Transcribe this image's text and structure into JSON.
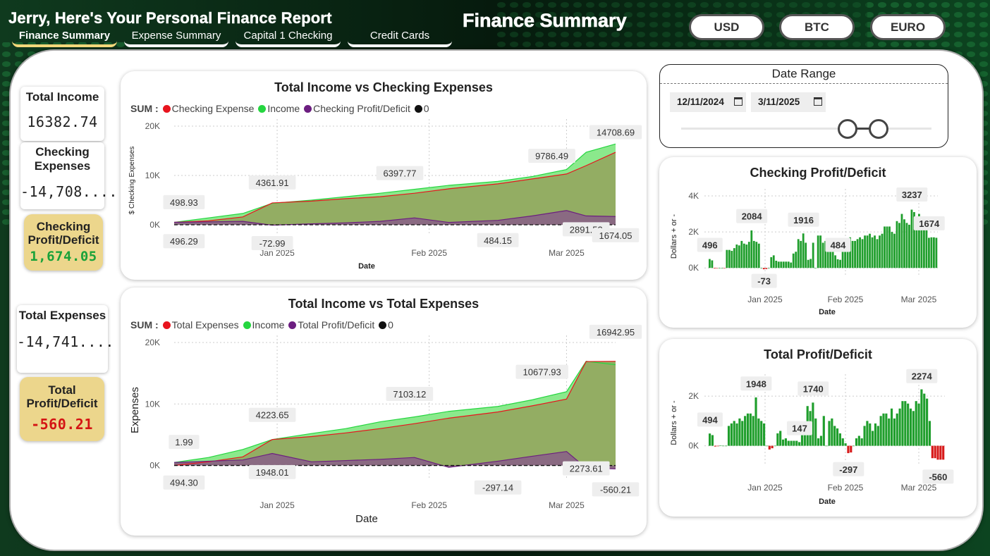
{
  "header": {
    "report_title": "Jerry, Here's Your Personal Finance Report",
    "page_heading": "Finance Summary",
    "tabs": [
      {
        "label": "Finance Summary",
        "active": true
      },
      {
        "label": "Expense Summary",
        "active": false
      },
      {
        "label": "Capital 1 Checking",
        "active": false
      },
      {
        "label": "Credit Cards",
        "active": false
      }
    ],
    "currency_buttons": [
      "USD",
      "BTC",
      "EURO"
    ]
  },
  "kpis": {
    "total_income": {
      "label": "Total Income",
      "value": "16382.74"
    },
    "checking_expenses": {
      "label": "Checking Expenses",
      "value": "-14,708...."
    },
    "checking_profit": {
      "label": "Checking Profit/Deficit",
      "value": "1,674.05",
      "color": "#1aa23a"
    },
    "total_expenses": {
      "label": "Total Expenses",
      "value": "-14,741...."
    },
    "total_profit": {
      "label": "Total Profit/Deficit",
      "value": "-560.21",
      "color": "#d41414"
    }
  },
  "date_range": {
    "label": "Date Range",
    "start": "12/11/2024",
    "end": "3/11/2025"
  },
  "colors": {
    "expense": "#e8141e",
    "income": "#25d640",
    "profit": "#6c1e80",
    "zero": "#111111",
    "area_income": "#8be98c",
    "area_expense": "#93ad63",
    "area_profit": "#8a6a82",
    "bar_pos": "#1f9e2c",
    "bar_neg": "#d71a1a",
    "gold": "#ecd68c"
  },
  "chart_data": [
    {
      "id": "income_vs_checking",
      "type": "area",
      "title": "Total Income vs Checking Expenses",
      "legend_title": "SUM :",
      "legend": [
        "Checking Expense",
        "Income",
        "Checking Profit/Deficit",
        "0"
      ],
      "xlabel": "Date",
      "ylabel": "$ Checking Expenses",
      "x_range": [
        "2024-12-11",
        "2025-03-11"
      ],
      "x_ticks": [
        {
          "date": "2025-01-01",
          "label": "Jan 2025"
        },
        {
          "date": "2025-02-01",
          "label": "Feb 2025"
        },
        {
          "date": "2025-03-01",
          "label": "Mar 2025"
        }
      ],
      "y_ticks": [
        {
          "v": 0,
          "label": "0K"
        },
        {
          "v": 10000,
          "label": "10K"
        },
        {
          "v": 20000,
          "label": "20K"
        }
      ],
      "ylim": [
        -2000,
        20000
      ],
      "series": [
        {
          "name": "Income",
          "points": [
            [
              "2024-12-11",
              496
            ],
            [
              "2024-12-18",
              1400
            ],
            [
              "2024-12-25",
              2300
            ],
            [
              "2024-12-31",
              4362
            ],
            [
              "2025-01-08",
              5000
            ],
            [
              "2025-01-15",
              5700
            ],
            [
              "2025-01-22",
              6398
            ],
            [
              "2025-01-29",
              7200
            ],
            [
              "2025-02-05",
              8000
            ],
            [
              "2025-02-15",
              8800
            ],
            [
              "2025-02-22",
              9786
            ],
            [
              "2025-03-01",
              11200
            ],
            [
              "2025-03-05",
              14709
            ],
            [
              "2025-03-11",
              16383
            ]
          ]
        },
        {
          "name": "Checking Expense",
          "points": [
            [
              "2024-12-11",
              499
            ],
            [
              "2024-12-18",
              800
            ],
            [
              "2024-12-25",
              1600
            ],
            [
              "2024-12-31",
              4435
            ],
            [
              "2025-01-08",
              4800
            ],
            [
              "2025-01-15",
              5300
            ],
            [
              "2025-01-22",
              5700
            ],
            [
              "2025-01-29",
              6400
            ],
            [
              "2025-02-05",
              7300
            ],
            [
              "2025-02-15",
              8300
            ],
            [
              "2025-02-22",
              9300
            ],
            [
              "2025-03-01",
              10300
            ],
            [
              "2025-03-05",
              12000
            ],
            [
              "2025-03-11",
              14708
            ]
          ]
        },
        {
          "name": "Checking Profit/Deficit",
          "points": [
            [
              "2024-12-11",
              496
            ],
            [
              "2024-12-18",
              600
            ],
            [
              "2024-12-25",
              700
            ],
            [
              "2024-12-31",
              -73
            ],
            [
              "2025-01-08",
              200
            ],
            [
              "2025-01-15",
              400
            ],
            [
              "2025-01-22",
              700
            ],
            [
              "2025-01-29",
              1400
            ],
            [
              "2025-02-05",
              484
            ],
            [
              "2025-02-15",
              900
            ],
            [
              "2025-02-22",
              1800
            ],
            [
              "2025-03-01",
              2892
            ],
            [
              "2025-03-05",
              1800
            ],
            [
              "2025-03-11",
              1674
            ]
          ]
        }
      ],
      "data_labels": [
        {
          "text": "498.93",
          "date": "2024-12-13",
          "v": 4300
        },
        {
          "text": "496.29",
          "date": "2024-12-13",
          "v": -3600
        },
        {
          "text": "4361.91",
          "date": "2024-12-31",
          "v": 8300
        },
        {
          "text": "-72.99",
          "date": "2024-12-31",
          "v": -4000
        },
        {
          "text": "6397.77",
          "date": "2025-01-26",
          "v": 10200
        },
        {
          "text": "484.15",
          "date": "2025-02-15",
          "v": -3400
        },
        {
          "text": "9786.49",
          "date": "2025-02-26",
          "v": 13700
        },
        {
          "text": "2891.53",
          "date": "2025-03-05",
          "v": -1200
        },
        {
          "text": "14708.69",
          "date": "2025-03-11",
          "v": 18500
        },
        {
          "text": "1674.05",
          "date": "2025-03-11",
          "v": -2400
        }
      ]
    },
    {
      "id": "income_vs_total",
      "type": "area",
      "title": "Total Income vs Total Expenses",
      "legend_title": "SUM :",
      "legend": [
        "Total Expenses",
        "Income",
        "Total Profit/Deficit",
        "0"
      ],
      "xlabel": "Date",
      "ylabel": "Expenses",
      "x_range": [
        "2024-12-11",
        "2025-03-11"
      ],
      "x_ticks": [
        {
          "date": "2025-01-01",
          "label": "Jan 2025"
        },
        {
          "date": "2025-02-01",
          "label": "Feb 2025"
        },
        {
          "date": "2025-03-01",
          "label": "Mar 2025"
        }
      ],
      "y_ticks": [
        {
          "v": 0,
          "label": "0K"
        },
        {
          "v": 10000,
          "label": "10K"
        },
        {
          "v": 20000,
          "label": "20K"
        }
      ],
      "ylim": [
        -2000,
        20000
      ],
      "series": [
        {
          "name": "Income",
          "points": [
            [
              "2024-12-11",
              494
            ],
            [
              "2024-12-18",
              1300
            ],
            [
              "2024-12-25",
              2600
            ],
            [
              "2024-12-31",
              4224
            ],
            [
              "2025-01-08",
              5200
            ],
            [
              "2025-01-15",
              6000
            ],
            [
              "2025-01-22",
              7103
            ],
            [
              "2025-01-29",
              7900
            ],
            [
              "2025-02-05",
              8800
            ],
            [
              "2025-02-15",
              9600
            ],
            [
              "2025-02-22",
              10678
            ],
            [
              "2025-03-01",
              12000
            ],
            [
              "2025-03-05",
              16943
            ],
            [
              "2025-03-11",
              16383
            ]
          ]
        },
        {
          "name": "Total Expenses",
          "points": [
            [
              "2024-12-11",
              2
            ],
            [
              "2024-12-18",
              600
            ],
            [
              "2024-12-25",
              1400
            ],
            [
              "2024-12-31",
              4224
            ],
            [
              "2025-01-08",
              4700
            ],
            [
              "2025-01-15",
              5300
            ],
            [
              "2025-01-22",
              6000
            ],
            [
              "2025-01-29",
              6800
            ],
            [
              "2025-02-05",
              7700
            ],
            [
              "2025-02-15",
              8700
            ],
            [
              "2025-02-22",
              9700
            ],
            [
              "2025-03-01",
              10800
            ],
            [
              "2025-03-05",
              16900
            ],
            [
              "2025-03-11",
              16943
            ]
          ]
        },
        {
          "name": "Total Profit/Deficit",
          "points": [
            [
              "2024-12-11",
              494
            ],
            [
              "2024-12-18",
              700
            ],
            [
              "2024-12-25",
              900
            ],
            [
              "2024-12-31",
              1948
            ],
            [
              "2025-01-08",
              600
            ],
            [
              "2025-01-15",
              800
            ],
            [
              "2025-01-22",
              1000
            ],
            [
              "2025-01-29",
              1300
            ],
            [
              "2025-02-05",
              -297
            ],
            [
              "2025-02-15",
              700
            ],
            [
              "2025-02-22",
              1500
            ],
            [
              "2025-03-01",
              2274
            ],
            [
              "2025-03-05",
              -400
            ],
            [
              "2025-03-11",
              -560
            ]
          ]
        }
      ],
      "data_labels": [
        {
          "text": "1.99",
          "date": "2024-12-13",
          "v": 3600
        },
        {
          "text": "494.30",
          "date": "2024-12-13",
          "v": -3000
        },
        {
          "text": "4223.65",
          "date": "2024-12-31",
          "v": 8000
        },
        {
          "text": "1948.01",
          "date": "2024-12-31",
          "v": -1300
        },
        {
          "text": "7103.12",
          "date": "2025-01-28",
          "v": 11400
        },
        {
          "text": "-297.14",
          "date": "2025-02-15",
          "v": -3800
        },
        {
          "text": "10677.93",
          "date": "2025-02-24",
          "v": 15000
        },
        {
          "text": "2273.61",
          "date": "2025-03-05",
          "v": -700
        },
        {
          "text": "16942.95",
          "date": "2025-03-11",
          "v": 21500
        },
        {
          "text": "-560.21",
          "date": "2025-03-11",
          "v": -4100
        }
      ]
    },
    {
      "id": "checking_profit_bars",
      "type": "bar",
      "title": "Checking Profit/Deficit",
      "xlabel": "Date",
      "ylabel": "Dollars + or -",
      "x_ticks": [
        "Jan 2025",
        "Feb 2025",
        "Mar 2025"
      ],
      "y_ticks": [
        {
          "v": 0,
          "label": "0K"
        },
        {
          "v": 2000,
          "label": "2K"
        },
        {
          "v": 4000,
          "label": "4K"
        }
      ],
      "ylim": [
        -500,
        4000
      ],
      "values": [
        496,
        420,
        -30,
        -20,
        5,
        0,
        -20,
        1000,
        1000,
        950,
        1100,
        1300,
        1250,
        1500,
        1350,
        1300,
        1450,
        2084,
        1500,
        1450,
        1350,
        0,
        -73,
        -60,
        0,
        600,
        700,
        400,
        350,
        350,
        350,
        350,
        350,
        300,
        800,
        900,
        1600,
        1500,
        1916,
        1400,
        450,
        500,
        1400,
        0,
        1800,
        1800,
        1400,
        1500,
        1300,
        1000,
        900,
        700,
        484,
        450,
        1200,
        1300,
        1000,
        1700,
        1500,
        1500,
        1600,
        1700,
        1600,
        1800,
        1800,
        1900,
        1700,
        1800,
        1600,
        1800,
        1900,
        2300,
        2300,
        2300,
        2000,
        1900,
        2600,
        2500,
        3000,
        2700,
        2500,
        2400,
        3237,
        3100,
        2500,
        3000,
        2800,
        2400,
        2300,
        1674,
        1700,
        1700,
        1674
      ],
      "data_labels": [
        {
          "text": "496",
          "index": 0,
          "v": 1200
        },
        {
          "text": "2084",
          "index": 17,
          "v": 2800
        },
        {
          "text": "-73",
          "index": 22,
          "v": -800
        },
        {
          "text": "1916",
          "index": 38,
          "v": 2600
        },
        {
          "text": "484",
          "index": 52,
          "v": 1200
        },
        {
          "text": "3237",
          "index": 82,
          "v": 4000
        },
        {
          "text": "1674",
          "index": 89,
          "v": 2400
        }
      ]
    },
    {
      "id": "total_profit_bars",
      "type": "bar",
      "title": "Total Profit/Deficit",
      "xlabel": "Date",
      "ylabel": "Dollars + or -",
      "x_ticks": [
        "Jan 2025",
        "Feb 2025",
        "Mar 2025"
      ],
      "y_ticks": [
        {
          "v": 0,
          "label": "0K"
        },
        {
          "v": 2000,
          "label": "2K"
        }
      ],
      "ylim": [
        -750,
        2600
      ],
      "values": [
        494,
        430,
        -30,
        -20,
        5,
        0,
        0,
        800,
        900,
        1000,
        900,
        1100,
        1000,
        1200,
        1300,
        1300,
        1200,
        1948,
        1100,
        1000,
        900,
        0,
        -150,
        -100,
        0,
        500,
        600,
        250,
        300,
        200,
        200,
        200,
        200,
        147,
        700,
        800,
        1600,
        1400,
        1740,
        1100,
        300,
        400,
        1200,
        0,
        1000,
        1100,
        800,
        700,
        500,
        300,
        100,
        -297,
        -270,
        0,
        300,
        400,
        300,
        800,
        1000,
        900,
        600,
        900,
        800,
        1200,
        1300,
        1300,
        1100,
        1500,
        1100,
        1300,
        1500,
        1800,
        1800,
        1700,
        1500,
        1400,
        1800,
        1700,
        2274,
        2100,
        1900,
        1000,
        -500,
        -500,
        -560,
        -560,
        -560
      ],
      "data_labels": [
        {
          "text": "494",
          "index": 0,
          "v": 1000
        },
        {
          "text": "1948",
          "index": 17,
          "v": 2450
        },
        {
          "text": "147",
          "index": 33,
          "v": 650
        },
        {
          "text": "1740",
          "index": 38,
          "v": 2250
        },
        {
          "text": "-297",
          "index": 51,
          "v": -1000
        },
        {
          "text": "2274",
          "index": 78,
          "v": 2750
        },
        {
          "text": "-560",
          "index": 84,
          "v": -1300
        }
      ]
    }
  ]
}
